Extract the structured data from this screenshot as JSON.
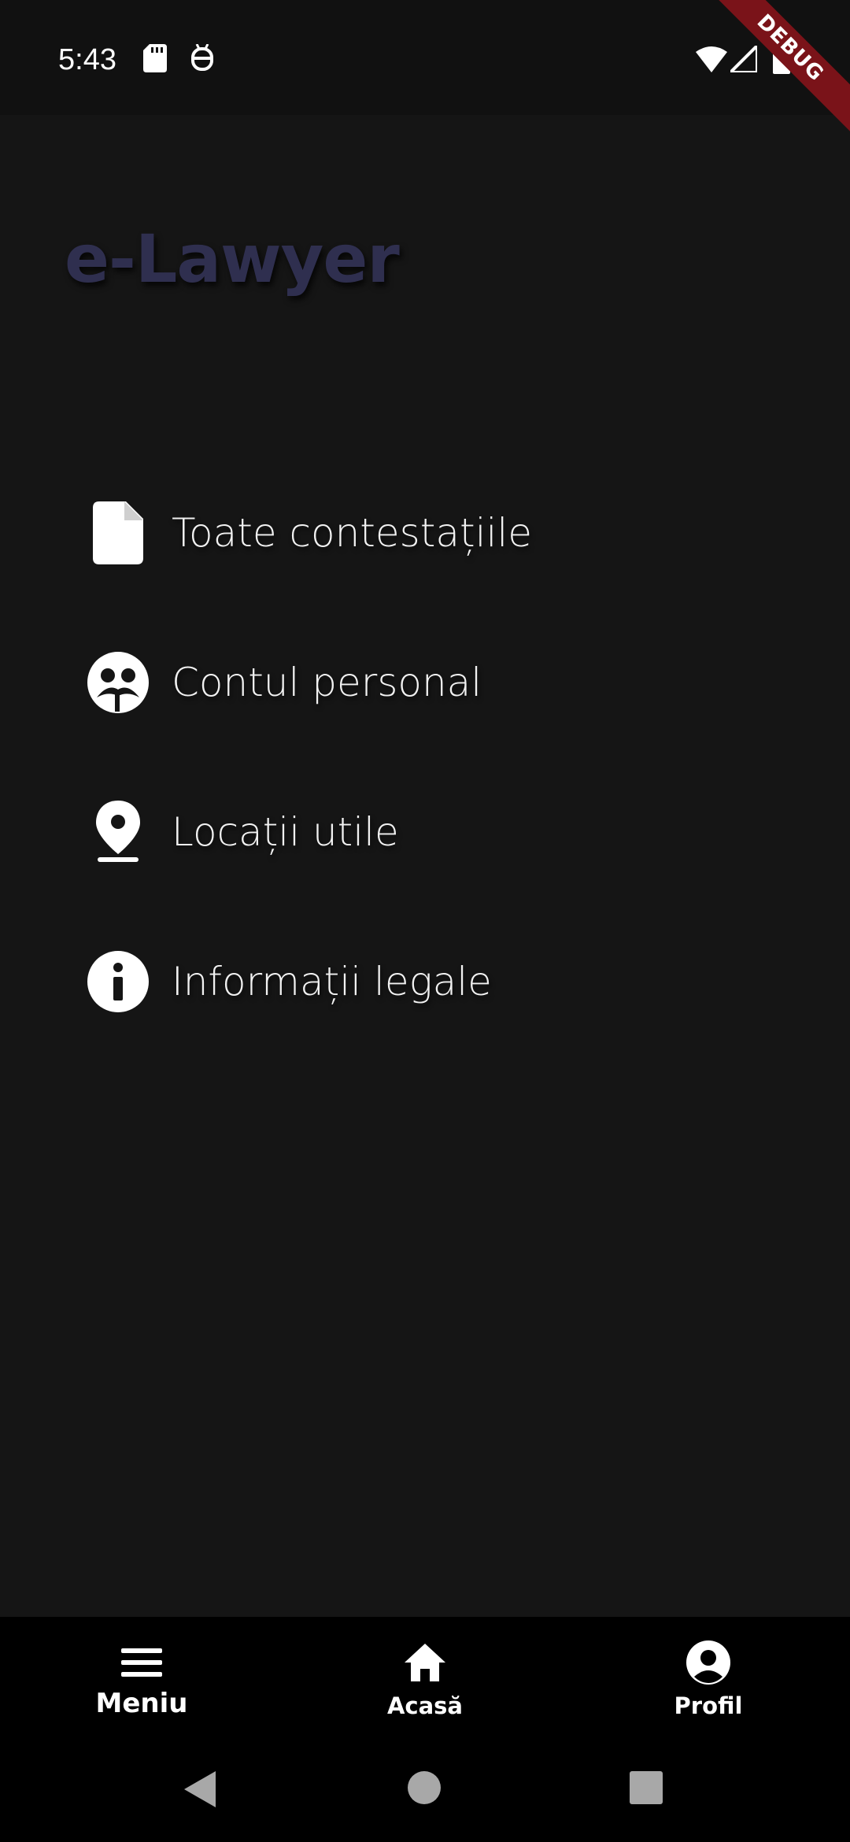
{
  "status_bar": {
    "time": "5:43",
    "left_icons": [
      "sd-card-icon",
      "android-robot-icon"
    ],
    "right_icons": [
      "wifi-icon",
      "cell-signal-icon",
      "battery-icon"
    ],
    "debug_label": "DEBUG"
  },
  "header": {
    "app_title": "e-Lawyer",
    "title_color": "#2f2f4f"
  },
  "menu": {
    "items": [
      {
        "icon": "document-icon",
        "label": "Toate contestațiile"
      },
      {
        "icon": "account-circle-icon",
        "label": "Contul personal"
      },
      {
        "icon": "location-pin-icon",
        "label": "Locații utile"
      },
      {
        "icon": "info-icon",
        "label": "Informații legale"
      }
    ]
  },
  "bottom_nav": {
    "items": [
      {
        "icon": "menu-icon",
        "label": "Meniu",
        "active": true
      },
      {
        "icon": "home-icon",
        "label": "Acasă",
        "active": false
      },
      {
        "icon": "profile-icon",
        "label": "Profil",
        "active": false
      }
    ]
  },
  "system_nav": {
    "buttons": [
      "back-triangle-icon",
      "home-circle-icon",
      "recents-square-icon"
    ]
  },
  "colors": {
    "background": "#151515",
    "status_bar": "#111111",
    "nav_bar": "#000000",
    "debug_banner": "#7a1319",
    "text": "#ffffff"
  }
}
